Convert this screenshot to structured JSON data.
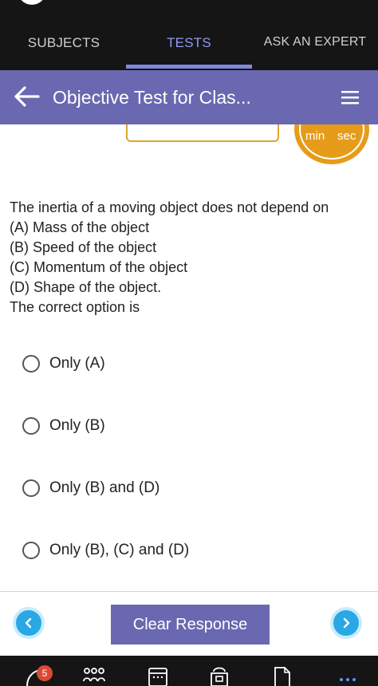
{
  "top_tabs": [
    {
      "label": "SUBJECTS",
      "active": false
    },
    {
      "label": "TESTS",
      "active": true
    },
    {
      "label": "ASK AN EXPERT",
      "active": false
    }
  ],
  "header": {
    "title": "Objective Test for Clas..."
  },
  "timer": {
    "min_label": "min",
    "sec_label": "sec"
  },
  "question": {
    "lines": [
      "The inertia of a moving object does not depend on",
      "(A) Mass of the object",
      "(B) Speed of the object",
      "(C) Momentum of the object",
      "(D) Shape of the object.",
      "The correct option is"
    ]
  },
  "options": [
    {
      "label": "Only (A)"
    },
    {
      "label": "Only (B)"
    },
    {
      "label": "Only (B) and (D)"
    },
    {
      "label": "Only (B), (C) and (D)"
    }
  ],
  "footer": {
    "clear_label": "Clear Response"
  },
  "bottom_nav": {
    "badge_count": "5"
  },
  "colors": {
    "accent": "#6a68b0",
    "tab_active": "#8e9cf0",
    "timer": "#e69c1a",
    "nav_button": "#2aa8e6",
    "badge": "#d94a36"
  }
}
